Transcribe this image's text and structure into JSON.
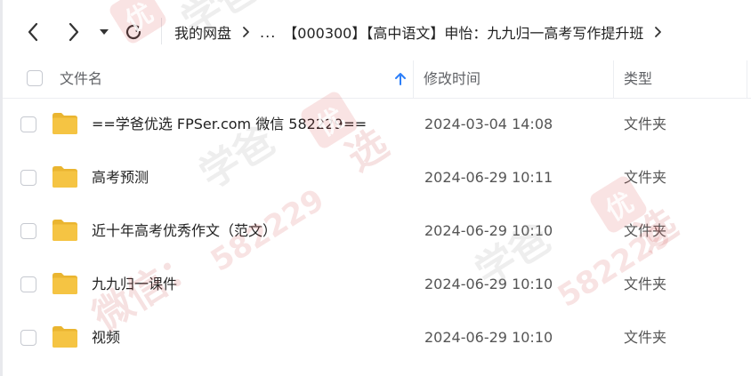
{
  "toolbar": {
    "back_icon": "chevron-left-icon",
    "forward_icon": "chevron-right-icon",
    "history_icon": "caret-down-icon",
    "refresh_icon": "refresh-icon"
  },
  "breadcrumb": {
    "root": "我的网盘",
    "ellipsis": "...",
    "current": "【000300】【高中语文】申怡：九九归一高考写作提升班",
    "separator_icon": "chevron-right-icon"
  },
  "table": {
    "headers": {
      "name": "文件名",
      "modified": "修改时间",
      "type": "类型"
    },
    "sort": {
      "column": "name",
      "icon": "arrow-up-icon",
      "color": "#2d7ff9"
    },
    "rows": [
      {
        "name": "==学爸优选 FPSer.com 微信 582229==",
        "modified": "2024-03-04 14:08",
        "type": "文件夹",
        "icon": "folder-icon"
      },
      {
        "name": "高考预测",
        "modified": "2024-06-29 10:11",
        "type": "文件夹",
        "icon": "folder-icon"
      },
      {
        "name": "近十年高考优秀作文（范文）",
        "modified": "2024-06-29 10:10",
        "type": "文件夹",
        "icon": "folder-icon"
      },
      {
        "name": "九九归一课件",
        "modified": "2024-06-29 10:10",
        "type": "文件夹",
        "icon": "folder-icon"
      },
      {
        "name": "视频",
        "modified": "2024-06-29 10:10",
        "type": "文件夹",
        "icon": "folder-icon"
      }
    ]
  },
  "watermark": {
    "brand": "学爸",
    "seal_char": "优",
    "seal_char_2": "选",
    "contact_label": "微信：",
    "contact_number": "582229",
    "color": "#d04646"
  },
  "colors": {
    "folder": "#f5c443",
    "folder_dark": "#eab530",
    "accent": "#2d7ff9",
    "border": "#eceef2"
  }
}
